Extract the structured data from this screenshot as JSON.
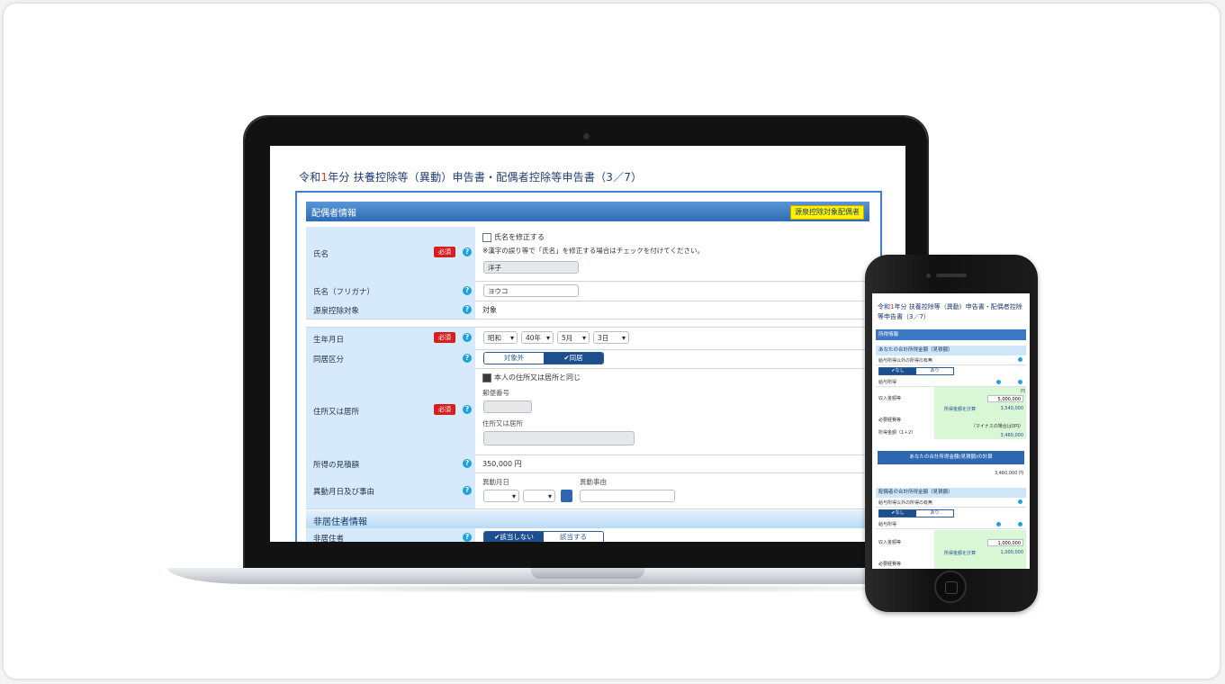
{
  "laptop": {
    "screen_title_pre": "令和",
    "screen_title_year": "1",
    "screen_title_post": "年分 扶養控除等（異動）申告書・配偶者控除等申告書（3／7）",
    "section_header": "配偶者情報",
    "section_tag": "源泉控除対象配偶者",
    "required_label": "必須",
    "help_glyph": "?",
    "name": {
      "label": "氏名",
      "checkbox_label": "氏名を修正する",
      "note": "※漢字の誤り等で「氏名」を修正する場合はチェックを付けてください。",
      "value": "洋子"
    },
    "furigana": {
      "label": "氏名（フリガナ）",
      "value": "ヨウコ"
    },
    "withholding": {
      "label": "源泉控除対象",
      "value": "対象"
    },
    "birthdate": {
      "label": "生年月日",
      "era": "昭和",
      "year": "40年",
      "month": "5月",
      "day": "3日"
    },
    "cohabit": {
      "label": "同居区分",
      "option_off": "対象外",
      "option_on": "✔同居"
    },
    "address": {
      "label": "住所又は居所",
      "same_as_self": "本人の住所又は居所と同じ",
      "postal_label": "郵便番号",
      "address_label": "住所又は居所"
    },
    "income": {
      "label": "所得の見積額",
      "value": "350,000 円"
    },
    "change": {
      "label": "異動月日及び事由",
      "date_label": "異動月日",
      "reason_label": "異動事由"
    },
    "nonresident_header": "非居住者情報",
    "nonresident": {
      "label": "非居住者",
      "option_on": "✔該当しない",
      "option_off": "該当する"
    }
  },
  "phone": {
    "title_pre": "令和",
    "title_year": "1",
    "title_post": "年分 扶養控除等（異動）申告書・配偶者控除等申告書（3／7）",
    "section_header": "所得情報",
    "self_income_header": "あなたの合計所得金額（見積額）",
    "row_salary_only": "給与所得以外の所得の有無",
    "toggle_on": "✔なし",
    "toggle_off": "あり",
    "row_salary": "給与所得",
    "row_gross": "収入金額等",
    "self_gross_value": "5,000,000",
    "unit_yen": "円",
    "link_calc": "所得金額を計算",
    "self_calc_value": "3,540,000",
    "row_other": "必要経費等",
    "other_note": "（マイナスの場合は0円）",
    "self_total_row": "所得金額（1＋2）",
    "self_total_value": "3,460,000",
    "calc_button": "あなたの合計所得金額(見積額)の計算",
    "self_result": "3,460,000 円",
    "spouse_income_header": "配偶者の合計所得金額（見積額）",
    "spouse_gross_value": "1,000,000",
    "spouse_calc_value": "1,000,000"
  }
}
